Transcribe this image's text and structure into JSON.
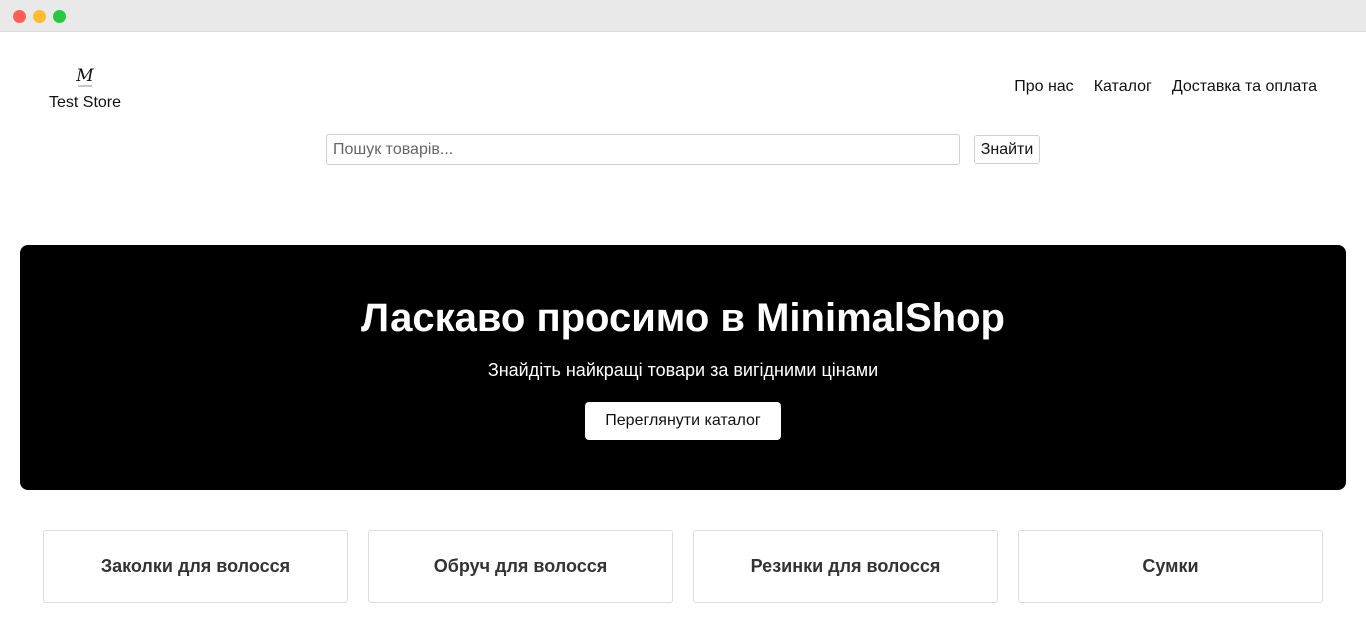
{
  "window": {
    "controls": [
      "close",
      "minimize",
      "maximize"
    ]
  },
  "header": {
    "logo_icon": "monogram-m-logo",
    "store_name": "Test Store",
    "nav": [
      {
        "label": "Про нас"
      },
      {
        "label": "Каталог"
      },
      {
        "label": "Доставка та оплата"
      }
    ]
  },
  "search": {
    "placeholder": "Пошук товарів...",
    "value": "",
    "button_label": "Знайти"
  },
  "hero": {
    "title": "Ласкаво просимо в MinimalShop",
    "subtitle": "Знайдіть найкращі товари за вигідними цінами",
    "button_label": "Переглянути каталог",
    "background_color": "#000000"
  },
  "categories": [
    {
      "label": "Заколки для волосся"
    },
    {
      "label": "Обруч для волосся"
    },
    {
      "label": "Резинки для волосся"
    },
    {
      "label": "Сумки"
    }
  ]
}
